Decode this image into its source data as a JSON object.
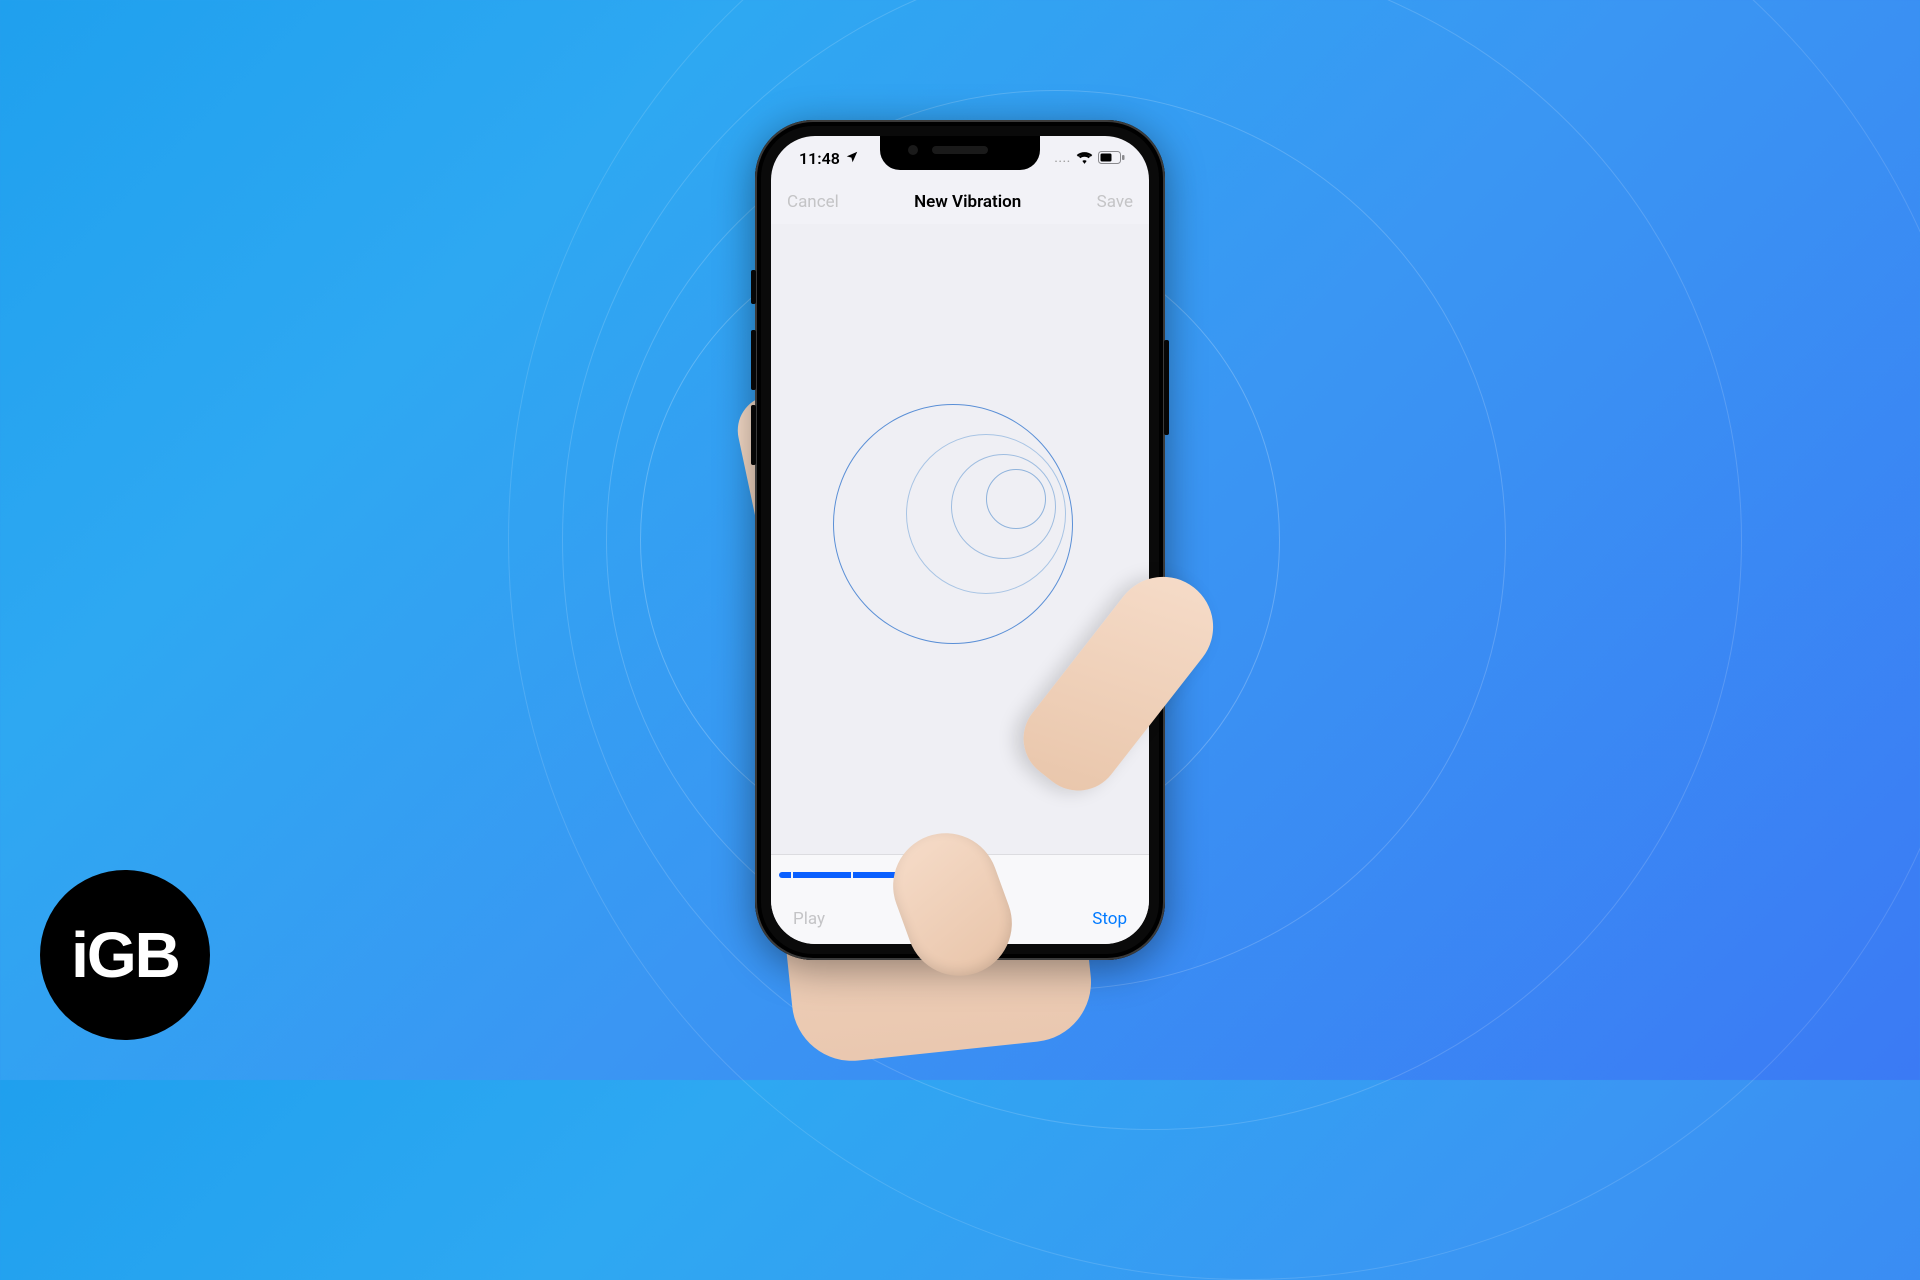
{
  "status": {
    "time": "11:48",
    "location_icon": "location-arrow",
    "signal_dots": "....",
    "wifi_icon": "wifi",
    "battery_icon": "battery-half"
  },
  "nav": {
    "cancel_label": "Cancel",
    "title": "New Vibration",
    "save_label": "Save"
  },
  "toolbar": {
    "play_label": "Play",
    "stop_label": "Stop"
  },
  "logo": {
    "text": "iGB"
  },
  "progress": {
    "fill_percent": 40
  }
}
